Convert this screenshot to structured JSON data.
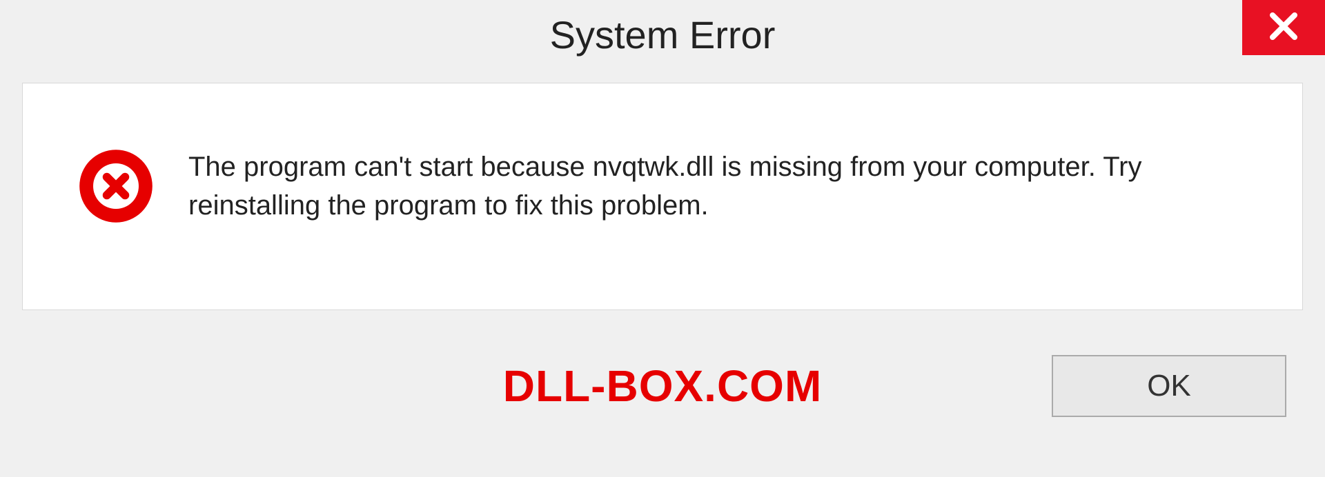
{
  "dialog": {
    "title": "System Error",
    "message": "The program can't start because nvqtwk.dll is missing from your computer. Try reinstalling the program to fix this problem.",
    "ok_label": "OK"
  },
  "watermark": "DLL-BOX.COM",
  "colors": {
    "close_bg": "#e81123",
    "error_icon": "#e60000",
    "watermark": "#e60000"
  }
}
